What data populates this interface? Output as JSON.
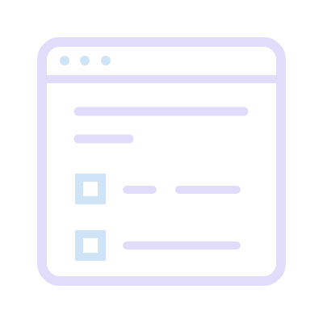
{
  "icon": {
    "name": "browser-window-checklist-icon",
    "colors": {
      "frame": "#e2dcfb",
      "dots": "#cfe4f6",
      "checkbox": "#cfe4f6",
      "lines": "#e2dcfb",
      "background": "#ffffff"
    },
    "window_dots": [
      "dot-1",
      "dot-2",
      "dot-3"
    ],
    "checklist_items": [
      {
        "name": "checklist-item-1",
        "checked": false
      },
      {
        "name": "checklist-item-2",
        "checked": false
      }
    ]
  }
}
